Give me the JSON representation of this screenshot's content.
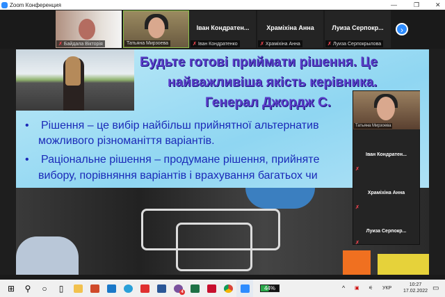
{
  "window": {
    "title": "Zoom Конференция",
    "minimize": "—",
    "restore": "❐",
    "close": "✕"
  },
  "strip": {
    "tiles": [
      {
        "label": "Байдала Вікторія",
        "video": true,
        "muted": true
      },
      {
        "label": "Татьяна Мирзоева",
        "video": true,
        "muted": false
      },
      {
        "name": "Іван  Кондратен...",
        "label": "Іван Кондратенко",
        "muted": true
      },
      {
        "name": "Храміхіна Анна",
        "label": "Храміхіна Анна",
        "muted": true
      },
      {
        "name": "Луиза  Серпокр...",
        "label": "Луиза Серпокрылова",
        "muted": true
      }
    ],
    "next_icon": "›"
  },
  "slide": {
    "title_lines": [
      "Будьте готові приймати рішення. Це",
      "найважливіша якість керівника.",
      "Генерал Джордж С."
    ],
    "bullet": "•",
    "bullets": [
      [
        "Рішення – це вибір найбільш прийнятної альтернатив",
        "можливого різноманіття варіантів."
      ],
      [
        "Раціональне рішення – продумане рішення, прийнятe",
        "вибору, порівняння варіантів і врахування багатьох чи"
      ]
    ]
  },
  "panel": {
    "speaker": "Татьяна Мирзоева",
    "participants": [
      "Іван  Кондратен...",
      "Храміхіна Анна",
      "Луиза  Серпокр..."
    ]
  },
  "taskbar": {
    "battery": "44%",
    "battery_level": 44,
    "language": "УКР",
    "time": "10:27",
    "date": "17.02.2022",
    "viber_badge": "4",
    "apps": [
      "start",
      "search",
      "cortana",
      "task-view",
      "file-explorer",
      "app-red",
      "mail",
      "edge",
      "app-book",
      "word",
      "viber",
      "excel",
      "acrobat",
      "chrome",
      "zoom"
    ]
  },
  "colors": {
    "accent": "#2d8cff",
    "slide_title": "#5a3cc8",
    "slide_text": "#1a2ab8",
    "mute": "#e0414b"
  }
}
